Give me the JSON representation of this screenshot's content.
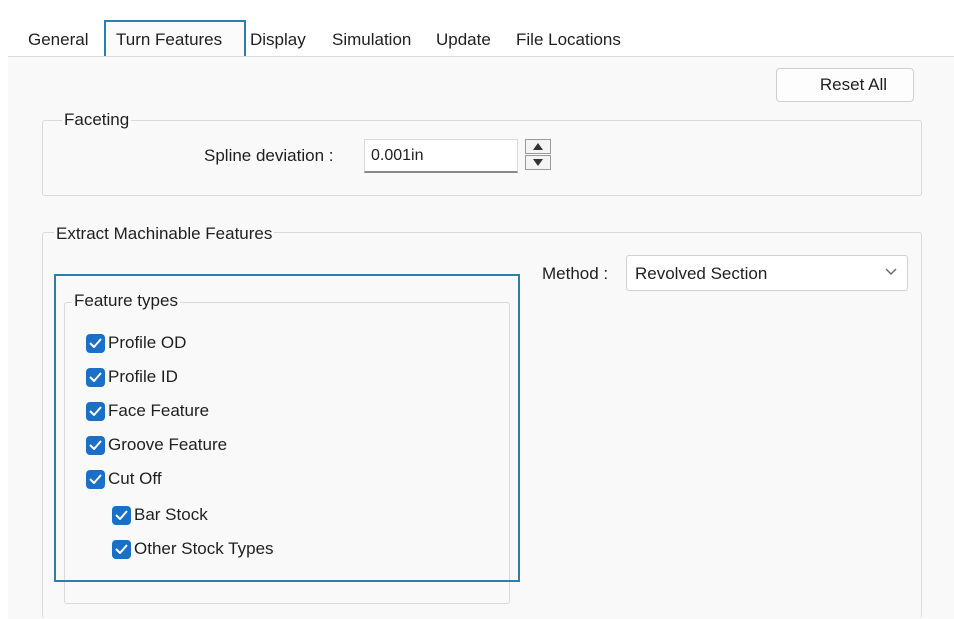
{
  "tabs": [
    {
      "label": "General",
      "active": false
    },
    {
      "label": "Turn Features",
      "active": true
    },
    {
      "label": "Display",
      "active": false
    },
    {
      "label": "Simulation",
      "active": false
    },
    {
      "label": "Update",
      "active": false
    },
    {
      "label": "File Locations",
      "active": false
    }
  ],
  "reset_all_label": "Reset All",
  "faceting": {
    "group_title": "Faceting",
    "spline_label": "Spline deviation :",
    "spline_value": "0.001in"
  },
  "extract": {
    "group_title": "Extract Machinable Features",
    "method_label": "Method :",
    "method_value": "Revolved Section",
    "feature_types_title": "Feature types",
    "features": [
      {
        "label": "Profile OD",
        "checked": true
      },
      {
        "label": "Profile ID",
        "checked": true
      },
      {
        "label": "Face Feature",
        "checked": true
      },
      {
        "label": "Groove Feature",
        "checked": true
      },
      {
        "label": "Cut Off",
        "checked": true
      },
      {
        "label": "Bar Stock",
        "checked": true
      },
      {
        "label": "Other Stock Types",
        "checked": true
      }
    ]
  },
  "colors": {
    "accent": "#1a6fc7",
    "highlight": "#2a7fb0"
  }
}
